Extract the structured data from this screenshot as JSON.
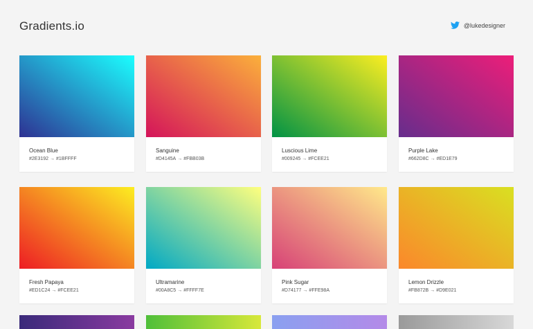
{
  "header": {
    "logo": "Gradients.io",
    "twitter_handle": "@lukedesigner",
    "twitter_icon": "twitter-bird-icon",
    "twitter_color": "#1DA1F2"
  },
  "arrow": "→",
  "gradients": [
    {
      "name": "Ocean Blue",
      "from": "#2E3192",
      "to": "#1BFFFF",
      "angle": "to top right"
    },
    {
      "name": "Sanguine",
      "from": "#D4145A",
      "to": "#FBB03B",
      "angle": "to top right"
    },
    {
      "name": "Luscious Lime",
      "from": "#009245",
      "to": "#FCEE21",
      "angle": "to top right"
    },
    {
      "name": "Purple Lake",
      "from": "#662D8C",
      "to": "#ED1E79",
      "angle": "to top right"
    },
    {
      "name": "Fresh Papaya",
      "from": "#ED1C24",
      "to": "#FCEE21",
      "angle": "to top right"
    },
    {
      "name": "Ultramarine",
      "from": "#00A8C5",
      "to": "#FFFF7E",
      "angle": "to top right"
    },
    {
      "name": "Pink Sugar",
      "from": "#D74177",
      "to": "#FFE98A",
      "angle": "to top right"
    },
    {
      "name": "Lemon Drizzle",
      "from": "#FB872B",
      "to": "#D9E021",
      "angle": "to top right"
    }
  ],
  "partial_row": [
    {
      "from": "#3a2a7a",
      "to": "#8a3aa0"
    },
    {
      "from": "#4fbf3a",
      "to": "#d8e83a"
    },
    {
      "from": "#8aa0f0",
      "to": "#b48ae8"
    },
    {
      "from": "#9a9a9a",
      "to": "#d8d8d8"
    }
  ]
}
